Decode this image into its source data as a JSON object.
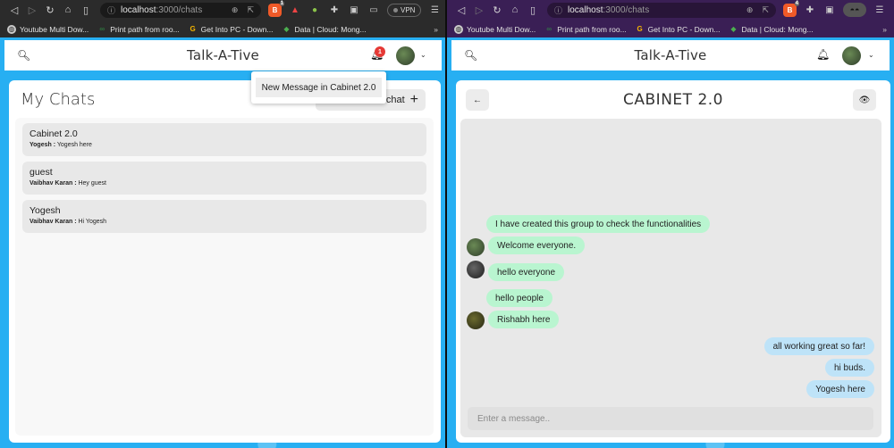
{
  "browser": {
    "url_host": "localhost",
    "url_path": ":3000/chats",
    "brave_count_left": "1",
    "brave_count_right": "4",
    "vpn_label": "VPN",
    "bookmarks": [
      {
        "label": "Youtube Multi Dow..."
      },
      {
        "label": "Print path from roo..."
      },
      {
        "label": "Get Into PC - Down..."
      },
      {
        "label": "Data | Cloud: Mong..."
      }
    ],
    "bookmarks_more": "»"
  },
  "app": {
    "title": "Talk-A-Tive",
    "notification_count": "1",
    "brand_color": "#27aff2"
  },
  "my_chats": {
    "title": "My Chats",
    "new_group_label": "chat",
    "chats": [
      {
        "name": "Cabinet 2.0",
        "sender": "Yogesh :",
        "message": "Yogesh here"
      },
      {
        "name": "guest",
        "sender": "Vaibhav Karan :",
        "message": "Hey guest"
      },
      {
        "name": "Yogesh",
        "sender": "Vaibhav Karan :",
        "message": "Hi Yogesh"
      }
    ]
  },
  "notification_menu": {
    "item": "New Message in Cabinet 2.0"
  },
  "chat_box": {
    "title": "CABINET 2.0",
    "input_placeholder": "Enter a message..",
    "messages": [
      {
        "text": "I have created this group to check the functionalities",
        "side": "other"
      },
      {
        "text": "Welcome everyone.",
        "side": "other"
      },
      {
        "text": "hello everyone",
        "side": "other"
      },
      {
        "text": "hello people",
        "side": "other"
      },
      {
        "text": "Rishabh here",
        "side": "other"
      },
      {
        "text": "all working great so far!",
        "side": "mine"
      },
      {
        "text": "hi buds.",
        "side": "mine"
      },
      {
        "text": "Yogesh here",
        "side": "mine"
      }
    ]
  }
}
